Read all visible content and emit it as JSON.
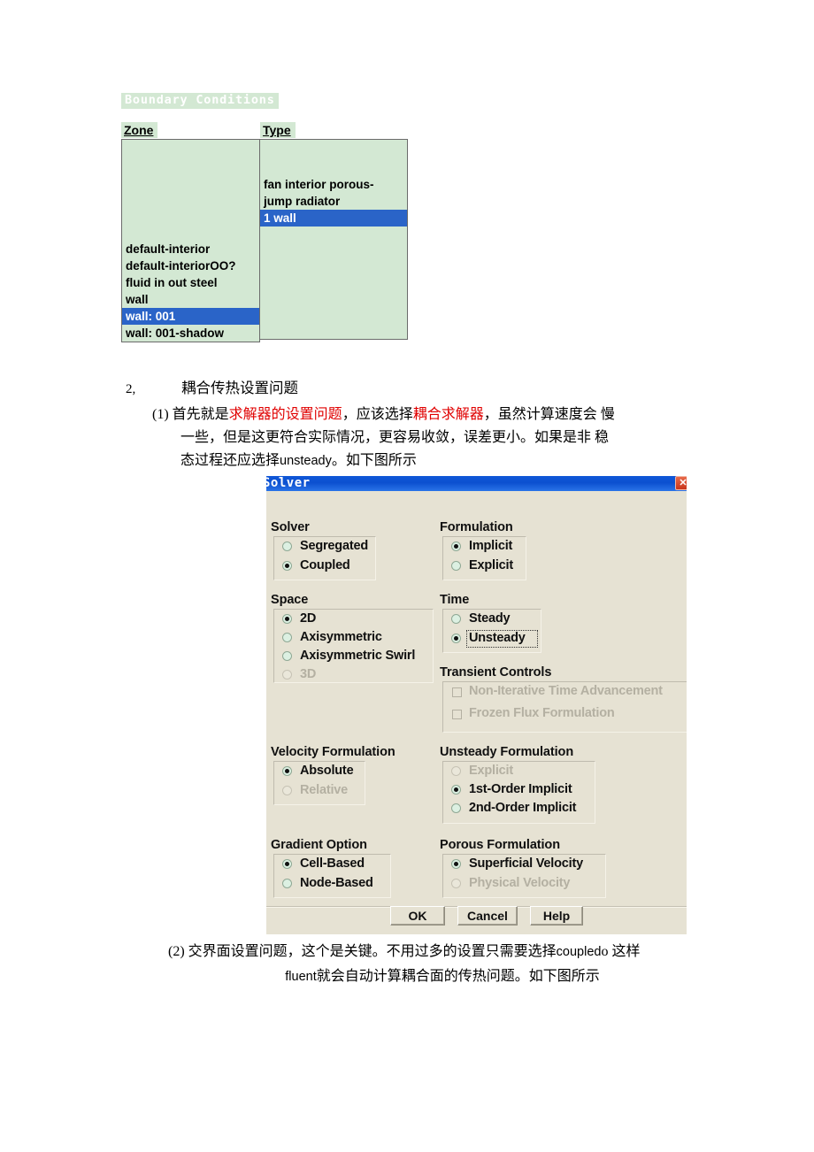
{
  "boundary_conditions": {
    "panel_title": "Boundary Conditions",
    "columns": {
      "zone": "Zone",
      "type": "Type"
    },
    "zone_items": [
      {
        "label": "default-interior",
        "selected": false
      },
      {
        "label": "default-interiorOO?",
        "selected": false
      },
      {
        "label": "fluid in out steel",
        "selected": false
      },
      {
        "label": "wall",
        "selected": false
      },
      {
        "label": "wall:  001",
        "selected": true
      },
      {
        "label": "wall:  001-shadow",
        "selected": false
      }
    ],
    "type_items": [
      {
        "label": "fan interior porous-",
        "selected": false
      },
      {
        "label": "jump radiator",
        "selected": false
      },
      {
        "label": "1 wall",
        "selected": true
      }
    ],
    "colors": {
      "list_background": "#d3e8d3",
      "selection": "#2a64c8",
      "title_text": "#ffffff"
    }
  },
  "document": {
    "section_number": "2,",
    "section_title": "耦合传热设置问题",
    "paragraph_1": {
      "line_1_a": "(1) 首先就是",
      "line_1_red_1": "求解器的设置问题",
      "line_1_b": "，应该选择",
      "line_1_red_2": "耦合求解器",
      "line_1_c": "，虽然计算速度会    慢",
      "line_2": "一些，但是这更符合实际情况，更容易收敛，误差更小。如果是非 稳",
      "line_3_a": "态过程还应选择",
      "line_3_latin": "unsteady",
      "line_3_b": "。如下图所示"
    },
    "paragraph_2": {
      "line_1_a": "(2) 交界面设置问题，这个是关键。不用过多的设置只需要选择",
      "line_1_latin": "coupled",
      "line_1_b": "o 这样",
      "line_2_latin": "fluent",
      "line_2_b": "就会自动计算耦合面的传热问题。如下图所示"
    },
    "colors": {
      "highlight_red": "#e00000",
      "body_text": "#000000"
    }
  },
  "solver_dialog": {
    "title": "Solver",
    "close_label": "✕",
    "groups": {
      "solver": {
        "label": "Solver",
        "options": [
          {
            "label": "Segregated",
            "checked": false,
            "enabled": true
          },
          {
            "label": "Coupled",
            "checked": true,
            "enabled": true
          }
        ]
      },
      "formulation": {
        "label": "Formulation",
        "options": [
          {
            "label": "Implicit",
            "checked": true,
            "enabled": true
          },
          {
            "label": "Explicit",
            "checked": false,
            "enabled": true
          }
        ]
      },
      "space": {
        "label": "Space",
        "options": [
          {
            "label": "2D",
            "checked": true,
            "enabled": true
          },
          {
            "label": "Axisymmetric",
            "checked": false,
            "enabled": true
          },
          {
            "label": "Axisymmetric Swirl",
            "checked": false,
            "enabled": true
          },
          {
            "label": "3D",
            "checked": false,
            "enabled": false
          }
        ]
      },
      "time": {
        "label": "Time",
        "options": [
          {
            "label": "Steady",
            "checked": false,
            "enabled": true
          },
          {
            "label": "Unsteady",
            "checked": true,
            "enabled": true,
            "focused": true
          }
        ]
      },
      "transient_controls": {
        "label": "Transient Controls",
        "options": [
          {
            "label": "Non-Iterative Time Advancement",
            "checked": false,
            "enabled": false
          },
          {
            "label": "Frozen Flux Formulation",
            "checked": false,
            "enabled": false
          }
        ]
      },
      "velocity_formulation": {
        "label": "Velocity Formulation",
        "options": [
          {
            "label": "Absolute",
            "checked": true,
            "enabled": true
          },
          {
            "label": "Relative",
            "checked": false,
            "enabled": false
          }
        ]
      },
      "unsteady_formulation": {
        "label": "Unsteady Formulation",
        "options": [
          {
            "label": "Explicit",
            "checked": false,
            "enabled": false
          },
          {
            "label": "1st-Order Implicit",
            "checked": true,
            "enabled": true
          },
          {
            "label": "2nd-Order Implicit",
            "checked": false,
            "enabled": true
          }
        ]
      },
      "gradient_option": {
        "label": "Gradient Option",
        "options": [
          {
            "label": "Cell-Based",
            "checked": true,
            "enabled": true
          },
          {
            "label": "Node-Based",
            "checked": false,
            "enabled": true
          }
        ]
      },
      "porous_formulation": {
        "label": "Porous Formulation",
        "options": [
          {
            "label": "Superficial Velocity",
            "checked": true,
            "enabled": true
          },
          {
            "label": "Physical Velocity",
            "checked": false,
            "enabled": false
          }
        ]
      }
    },
    "buttons": {
      "ok": "OK",
      "cancel": "Cancel",
      "help": "Help"
    },
    "colors": {
      "titlebar": "#0c50d0",
      "dialog_face": "#e6e2d3",
      "radio_face": "#dcf0e2",
      "disabled_text": "#b4b0a2"
    }
  }
}
